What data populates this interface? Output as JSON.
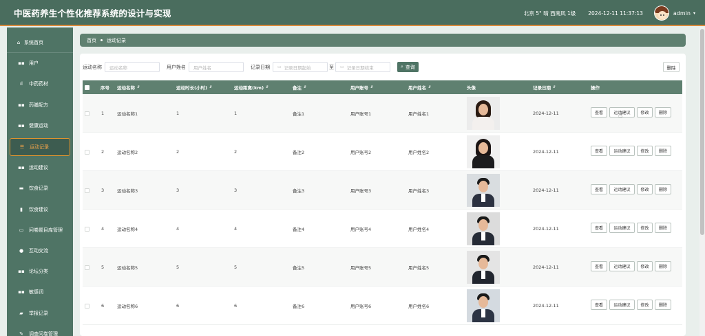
{
  "header": {
    "title": "中医药养生个性化推荐系统的设计与实现",
    "weather": "北京  5°  晴  西南风  1级",
    "datetime": "2024-12-11 11:37:13",
    "username": "admin",
    "caret": "▾"
  },
  "sidebar": {
    "items": [
      {
        "label": "系统首页",
        "icon": "home-icon",
        "glyph": "⌂"
      },
      {
        "label": "用户",
        "icon": "grid-icon",
        "glyph": "▪▪"
      },
      {
        "label": "中药药材",
        "icon": "bar-chart-icon",
        "glyph": "ıl"
      },
      {
        "label": "药膳配方",
        "icon": "grid-icon",
        "glyph": "▪▪"
      },
      {
        "label": "健康运动",
        "icon": "grid-icon",
        "glyph": "▪▪"
      },
      {
        "label": "运动记录",
        "icon": "sliders-icon",
        "glyph": "☰"
      },
      {
        "label": "运动建议",
        "icon": "grid-icon",
        "glyph": "▪▪"
      },
      {
        "label": "饮食记录",
        "icon": "tray-icon",
        "glyph": "▬"
      },
      {
        "label": "饮食建议",
        "icon": "clipboard-icon",
        "glyph": "▮"
      },
      {
        "label": "问卷题目库管理",
        "icon": "tv-icon",
        "glyph": "▭"
      },
      {
        "label": "互动交流",
        "icon": "pin-icon",
        "glyph": "●"
      },
      {
        "label": "论坛分类",
        "icon": "grid-icon",
        "glyph": "▪▪"
      },
      {
        "label": "敏感词",
        "icon": "grid-icon",
        "glyph": "▪▪"
      },
      {
        "label": "举报记录",
        "icon": "comment-icon",
        "glyph": "▰"
      },
      {
        "label": "调查问卷管理",
        "icon": "edit-icon",
        "glyph": "✎"
      }
    ],
    "active_index": 5
  },
  "breadcrumb": {
    "home": "首页",
    "current": "运动记录"
  },
  "search": {
    "label_name": "运动名称",
    "placeholder_name": "运动名称",
    "label_user": "用户姓名",
    "placeholder_user": "用户姓名",
    "label_date": "记录日期",
    "placeholder_start": "记录日期起始",
    "to": "至",
    "placeholder_end": "记录日期结束",
    "search_btn": "查询",
    "delete_btn": "删除"
  },
  "table": {
    "headers": [
      "序号",
      "运动名称",
      "运动时长(小时)",
      "运动距离(km)",
      "备注",
      "用户账号",
      "用户姓名",
      "头像",
      "记录日期",
      "操作"
    ],
    "rows": [
      {
        "no": "1",
        "name": "运动名称1",
        "duration": "1",
        "distance": "1",
        "note": "备注1",
        "account": "用户账号1",
        "user": "用户姓名1",
        "date": "2024-12-11"
      },
      {
        "no": "2",
        "name": "运动名称2",
        "duration": "2",
        "distance": "2",
        "note": "备注2",
        "account": "用户账号2",
        "user": "用户姓名2",
        "date": "2024-12-11"
      },
      {
        "no": "3",
        "name": "运动名称3",
        "duration": "3",
        "distance": "3",
        "note": "备注3",
        "account": "用户账号3",
        "user": "用户姓名3",
        "date": "2024-12-11"
      },
      {
        "no": "4",
        "name": "运动名称4",
        "duration": "4",
        "distance": "4",
        "note": "备注4",
        "account": "用户账号4",
        "user": "用户姓名4",
        "date": "2024-12-11"
      },
      {
        "no": "5",
        "name": "运动名称5",
        "duration": "5",
        "distance": "5",
        "note": "备注5",
        "account": "用户账号5",
        "user": "用户姓名5",
        "date": "2024-12-11"
      },
      {
        "no": "6",
        "name": "运动名称6",
        "duration": "6",
        "distance": "6",
        "note": "备注6",
        "account": "用户账号6",
        "user": "用户姓名6",
        "date": "2024-12-11"
      }
    ],
    "actions": {
      "view": "查看",
      "suggest": "运动建议",
      "edit": "修改",
      "delete": "删除"
    }
  },
  "colors": {
    "primary": "#4f7465",
    "header": "#4a6d5e",
    "accent": "#e0942e"
  }
}
